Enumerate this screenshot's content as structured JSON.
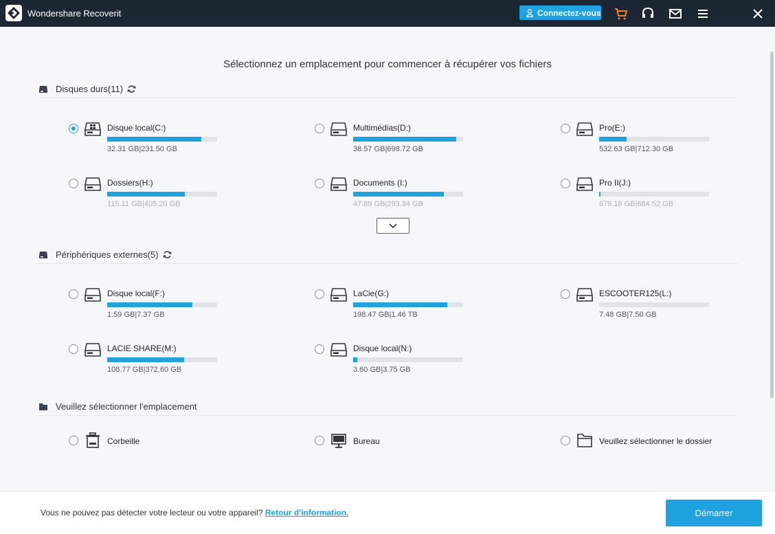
{
  "app": {
    "title": "Wondershare Recoverit"
  },
  "titlebar": {
    "login_label": "Connectez-vous"
  },
  "headline": "Sélectionnez un emplacement pour commencer à récupérer vos fichiers",
  "hard_disks": {
    "title": "Disques durs(11)",
    "drives": [
      {
        "name": "Disque local(C:)",
        "size": "32.31 GB|231.50 GB",
        "used_fraction": 0.86,
        "selected": true,
        "icon": "windows-drive-icon"
      },
      {
        "name": "Multimédias(D:)",
        "size": "38.57 GB|698.72 GB",
        "used_fraction": 0.94,
        "selected": false,
        "icon": "hard-drive-icon"
      },
      {
        "name": "Pro(E:)",
        "size": "532.63 GB|712.30 GB",
        "used_fraction": 0.25,
        "selected": false,
        "icon": "hard-drive-icon"
      },
      {
        "name": "Dossiers(H:)",
        "size": "115.11 GB|405.20 GB",
        "used_fraction": 0.71,
        "selected": false,
        "icon": "hard-drive-icon"
      },
      {
        "name": "Documents (I:)",
        "size": "47.89 GB|293.34 GB",
        "used_fraction": 0.84,
        "selected": false,
        "icon": "hard-drive-icon"
      },
      {
        "name": "Pro II(J:)",
        "size": "679.18 GB|684.52 GB",
        "used_fraction": 0.01,
        "selected": false,
        "icon": "hard-drive-icon"
      }
    ]
  },
  "external_devices": {
    "title": "Périphériques externes(5)",
    "drives": [
      {
        "name": "Disque local(F:)",
        "size": "1.59 GB|7.37 GB",
        "used_fraction": 0.78,
        "icon": "hard-drive-icon"
      },
      {
        "name": "LaCie(G:)",
        "size": "198.47 GB|1.46 TB",
        "used_fraction": 0.86,
        "icon": "hard-drive-icon"
      },
      {
        "name": "ESCOOTER125(L:)",
        "size": "7.48 GB|7.50 GB",
        "used_fraction": 0.0,
        "icon": "hard-drive-icon"
      },
      {
        "name": "LACIE SHARE(M:)",
        "size": "108.77 GB|372.60 GB",
        "used_fraction": 0.7,
        "icon": "hard-drive-icon"
      },
      {
        "name": "Disque local(N:)",
        "size": "3.60 GB|3.75 GB",
        "used_fraction": 0.04,
        "icon": "hard-drive-icon"
      }
    ]
  },
  "locations": {
    "title": "Veuillez sélectionner l'emplacement",
    "items": [
      {
        "name": "Corbeille",
        "icon": "trash-icon"
      },
      {
        "name": "Bureau",
        "icon": "desktop-icon"
      },
      {
        "name": "Veuillez sélectionner le dossier",
        "icon": "folder-icon"
      }
    ]
  },
  "footer": {
    "text": "Vous ne pouvez pas détecter votre lecteur ou votre appareil?",
    "link": "Retour d'information.",
    "start_label": "Démarrer"
  },
  "colors": {
    "accent": "#1fa3e0",
    "titlebar": "#1d2633",
    "cart": "#f5821f"
  }
}
